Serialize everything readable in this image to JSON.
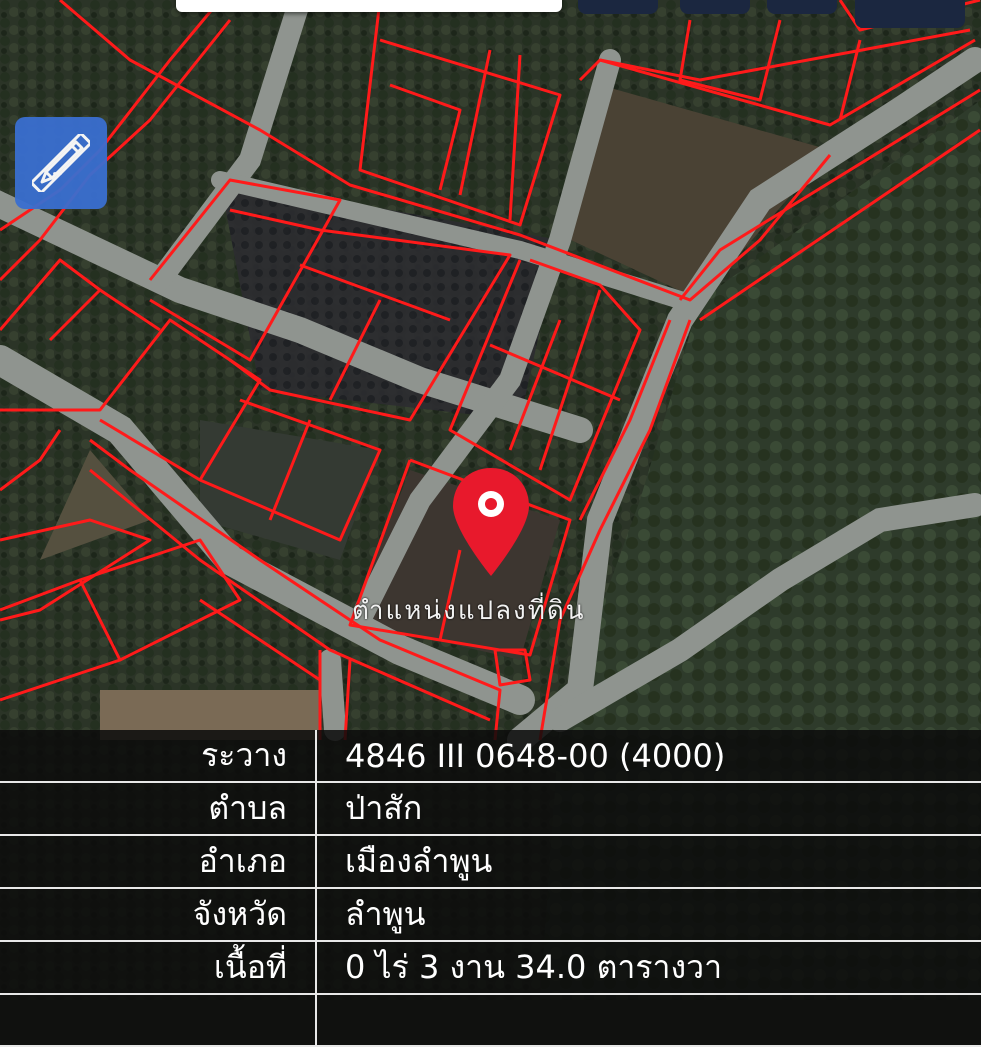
{
  "map": {
    "pin_label": "ตำแหน่งแปลงที่ดิน",
    "pin_color": "#e8192c",
    "parcel_line_color": "#ff1a1a",
    "road_color": "#8f948f",
    "pin_icon": "map-pin-icon",
    "tool_icon": "pencil-ruler-icon",
    "tool_button_color": "#3a6fd0"
  },
  "parcel": {
    "rows": [
      {
        "label": "ระวาง",
        "value": "4846 III 0648-00 (4000)"
      },
      {
        "label": "ตำบล",
        "value": "ป่าสัก"
      },
      {
        "label": "อำเภอ",
        "value": "เมืองลำพูน"
      },
      {
        "label": "จังหวัด",
        "value": "ลำพูน"
      },
      {
        "label": "เนื้อที่",
        "value": "0 ไร่ 3 งาน 34.0 ตารางวา"
      },
      {
        "label": "",
        "value": ""
      }
    ]
  }
}
